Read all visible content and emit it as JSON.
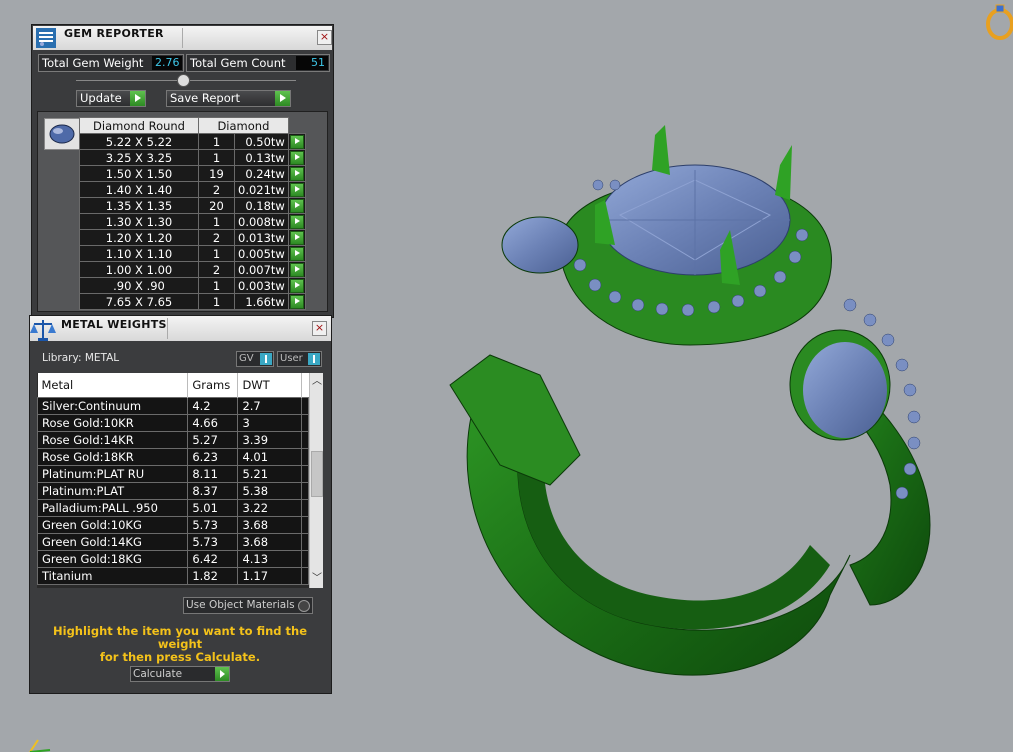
{
  "gem_reporter": {
    "title": "GEM REPORTER",
    "close_label": "×",
    "total_gem_weight_label": "Total Gem Weight",
    "total_gem_weight_value": "2.76",
    "total_gem_count_label": "Total Gem Count",
    "total_gem_count_value": "51",
    "update_label": "Update",
    "save_report_label": "Save Report",
    "shape_header": "Diamond Round",
    "type_header": "Diamond",
    "rows": [
      {
        "size": "5.22 X 5.22",
        "count": "1",
        "weight": "0.50tw"
      },
      {
        "size": "3.25 X 3.25",
        "count": "1",
        "weight": "0.13tw"
      },
      {
        "size": "1.50 X 1.50",
        "count": "19",
        "weight": "0.24tw"
      },
      {
        "size": "1.40 X 1.40",
        "count": "2",
        "weight": "0.021tw"
      },
      {
        "size": "1.35 X 1.35",
        "count": "20",
        "weight": "0.18tw"
      },
      {
        "size": "1.30 X 1.30",
        "count": "1",
        "weight": "0.008tw"
      },
      {
        "size": "1.20 X 1.20",
        "count": "2",
        "weight": "0.013tw"
      },
      {
        "size": "1.10 X 1.10",
        "count": "1",
        "weight": "0.005tw"
      },
      {
        "size": "1.00 X 1.00",
        "count": "2",
        "weight": "0.007tw"
      },
      {
        "size": ".90 X .90",
        "count": "1",
        "weight": "0.003tw"
      },
      {
        "size": "7.65 X 7.65",
        "count": "1",
        "weight": "1.66tw"
      }
    ]
  },
  "metal_weights": {
    "title": "METAL WEIGHTS",
    "close_label": "×",
    "library_label": "Library: METAL",
    "gv_label": "GV",
    "user_label": "User",
    "columns": [
      "Metal",
      "Grams",
      "DWT"
    ],
    "rows": [
      {
        "metal": "Silver:Continuum",
        "grams": "4.2",
        "dwt": "2.7"
      },
      {
        "metal": "Rose Gold:10KR",
        "grams": "4.66",
        "dwt": "3"
      },
      {
        "metal": "Rose Gold:14KR",
        "grams": "5.27",
        "dwt": "3.39"
      },
      {
        "metal": "Rose Gold:18KR",
        "grams": "6.23",
        "dwt": "4.01"
      },
      {
        "metal": "Platinum:PLAT RU",
        "grams": "8.11",
        "dwt": "5.21"
      },
      {
        "metal": "Platinum:PLAT",
        "grams": "8.37",
        "dwt": "5.38"
      },
      {
        "metal": "Palladium:PALL .950",
        "grams": "5.01",
        "dwt": "3.22"
      },
      {
        "metal": "Green Gold:10KG",
        "grams": "5.73",
        "dwt": "3.68"
      },
      {
        "metal": "Green Gold:14KG",
        "grams": "5.73",
        "dwt": "3.68"
      },
      {
        "metal": "Green Gold:18KG",
        "grams": "6.42",
        "dwt": "4.13"
      },
      {
        "metal": "Titanium",
        "grams": "1.82",
        "dwt": "1.17"
      }
    ],
    "use_object_materials_label": "Use Object Materials",
    "hint_line1": "Highlight the item you want to find the weight",
    "hint_line2": "for then press Calculate.",
    "calculate_label": "Calculate"
  },
  "colors": {
    "panel_bg": "#3a3b3d",
    "value_text": "#3ec7e8",
    "hint_text": "#f4c21a",
    "ring_green": "#1f7a1a",
    "gem_blue": "#6f86b8"
  }
}
